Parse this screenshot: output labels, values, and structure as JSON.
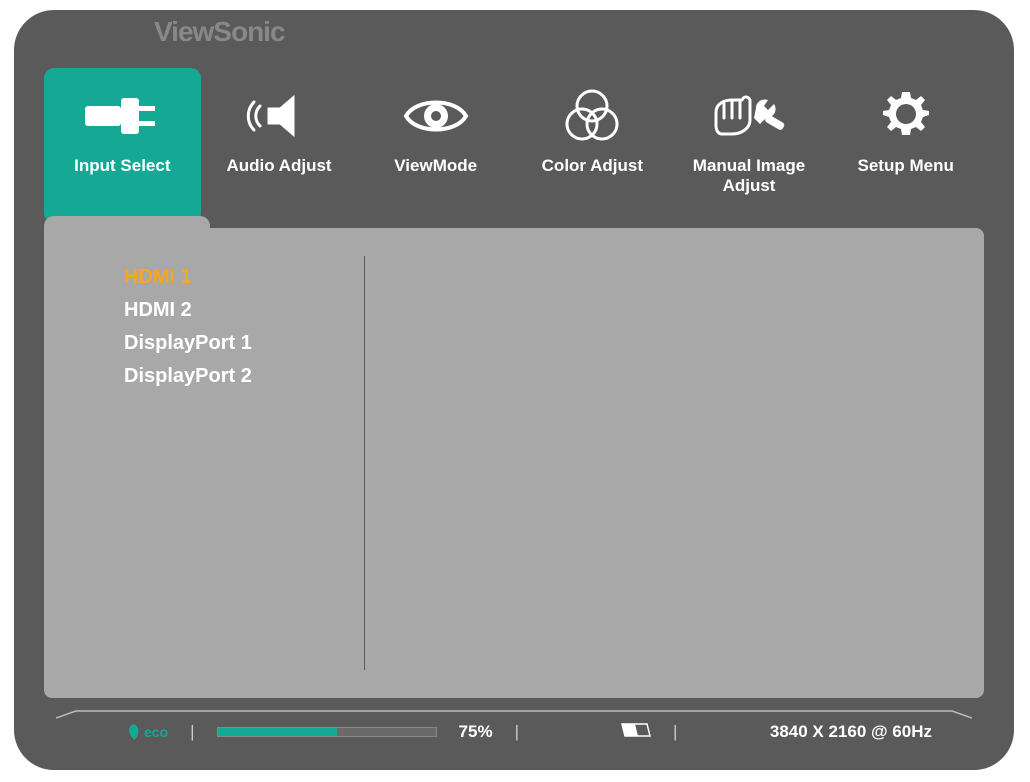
{
  "brand": "ViewSonic",
  "tabs": [
    {
      "id": "input-select",
      "label": "Input Select",
      "icon": "plug",
      "active": true
    },
    {
      "id": "audio-adjust",
      "label": "Audio Adjust",
      "icon": "speaker",
      "active": false
    },
    {
      "id": "viewmode",
      "label": "ViewMode",
      "icon": "eye",
      "active": false
    },
    {
      "id": "color-adjust",
      "label": "Color Adjust",
      "icon": "venn",
      "active": false
    },
    {
      "id": "manual-image-adjust",
      "label": "Manual Image Adjust",
      "icon": "hand-wrench",
      "active": false
    },
    {
      "id": "setup-menu",
      "label": "Setup Menu",
      "icon": "gear",
      "active": false
    }
  ],
  "options": [
    {
      "label": "HDMI 1",
      "selected": true
    },
    {
      "label": "HDMI 2",
      "selected": false
    },
    {
      "label": "DisplayPort 1",
      "selected": false
    },
    {
      "label": "DisplayPort 2",
      "selected": false
    }
  ],
  "status": {
    "eco_label": "eco",
    "progress_value": "75%",
    "progress_percent": 55,
    "resolution": "3840 X 2160 @ 60Hz"
  },
  "colors": {
    "teal": "#14a895",
    "orange": "#f5a623"
  }
}
